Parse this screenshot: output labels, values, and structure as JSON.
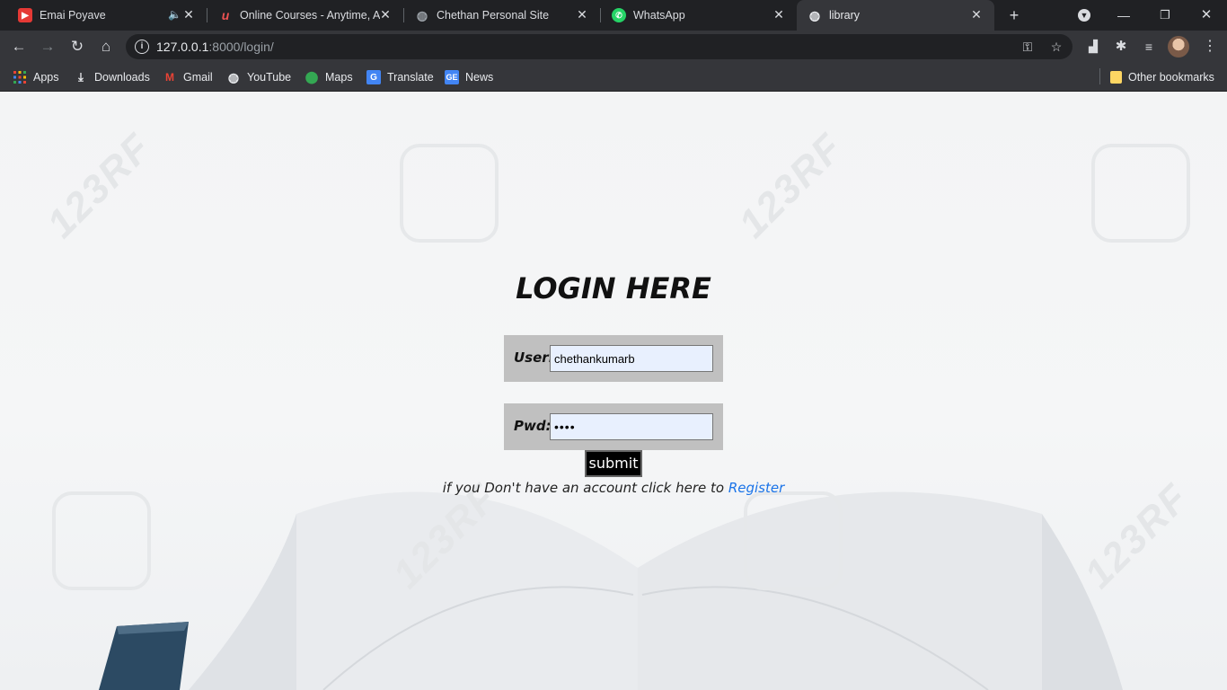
{
  "tabs": [
    {
      "title": "Emai Poyave",
      "favicon": "youtube-icon",
      "active": false
    },
    {
      "title": "Online Courses - Anytime, An",
      "favicon": "udemy-icon",
      "active": false
    },
    {
      "title": "Chethan Personal Site",
      "favicon": "globe-icon",
      "active": false
    },
    {
      "title": "WhatsApp",
      "favicon": "whatsapp-icon",
      "active": false
    },
    {
      "title": "library",
      "favicon": "globe-icon",
      "active": true
    }
  ],
  "toolbar": {
    "url_host": "127.0.0.1",
    "url_path": ":8000/login/"
  },
  "bookmarks": {
    "items": [
      {
        "label": "Apps",
        "icon": "apps-grid-icon"
      },
      {
        "label": "Downloads",
        "icon": "download-icon"
      },
      {
        "label": "Gmail",
        "icon": "gmail-icon"
      },
      {
        "label": "YouTube",
        "icon": "globe-icon"
      },
      {
        "label": "Maps",
        "icon": "maps-pin-icon"
      },
      {
        "label": "Translate",
        "icon": "translate-icon"
      },
      {
        "label": "News",
        "icon": "news-icon"
      }
    ],
    "other": "Other bookmarks"
  },
  "login": {
    "heading": "LOGIN HERE",
    "user_label": "User:",
    "user_value": "chethankumarb",
    "pwd_label": "Pwd:",
    "pwd_value": "••••",
    "submit_label": "submit",
    "register_prompt": "if you Don't have an account click here to",
    "register_link": "Register"
  },
  "watermark": "123RF",
  "colors": {
    "chrome_dark": "#202124",
    "chrome_toolbar": "#35363a",
    "field_box": "#c0c0c0",
    "input_autofill": "#e8f0fe",
    "link": "#1a73e8"
  }
}
